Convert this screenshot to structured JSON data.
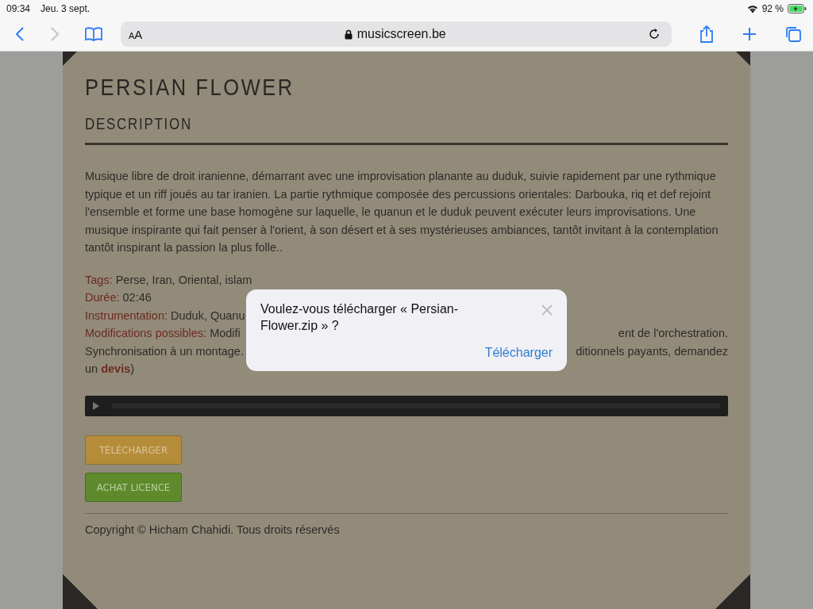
{
  "status_bar": {
    "time": "09:34",
    "date": "Jeu. 3 sept.",
    "battery": "92 %"
  },
  "toolbar": {
    "forward_disabled": true,
    "text_size": "AA",
    "url": "musicscreen.be"
  },
  "page": {
    "title": "PERSIAN FLOWER",
    "section": "DESCRIPTION",
    "description": "Musique libre de droit iranienne, démarrant avec une improvisation planante au duduk, suivie rapidement par une rythmique typique et un riff joués au tar iranien. La partie rythmique composée des percussions orientales: Darbouka, riq et def rejoint l'ensemble et forme une base homogène sur laquelle, le quanun et le duduk peuvent exécuter leurs improvisations. Une musique inspirante qui fait penser à l'orient, à son désert et à ses mystérieuses ambiances, tantôt invitant à la contemplation tantôt inspirant la passion la plus folle..",
    "details": [
      {
        "label": "Tags:",
        "value": "Perse, Iran, Oriental, islam"
      },
      {
        "label": "Durée:",
        "value": "02:46"
      },
      {
        "label": "Instrumentation:",
        "value": "Duduk, Quanu"
      },
      {
        "label": "Modifications possibles:",
        "value": "Modifi",
        "right": "ent de l'orchestration."
      },
      {
        "value": "Synchronisation à un montage.",
        "right": "ditionnels payants, demandez"
      }
    ],
    "last_line": {
      "prefix": "un",
      "link": "devis",
      "suffix": ")"
    },
    "buttons": [
      {
        "label": "TÉLÉCHARGER",
        "kind": "download"
      },
      {
        "label": "ACHAT LICENCE",
        "kind": "license"
      }
    ],
    "footer": "Copyright © Hicham Chahidi. Tous droits réservés"
  },
  "dialog": {
    "message": "Voulez-vous télécharger « Persian-Flower.zip » ?",
    "action": "Télécharger"
  }
}
